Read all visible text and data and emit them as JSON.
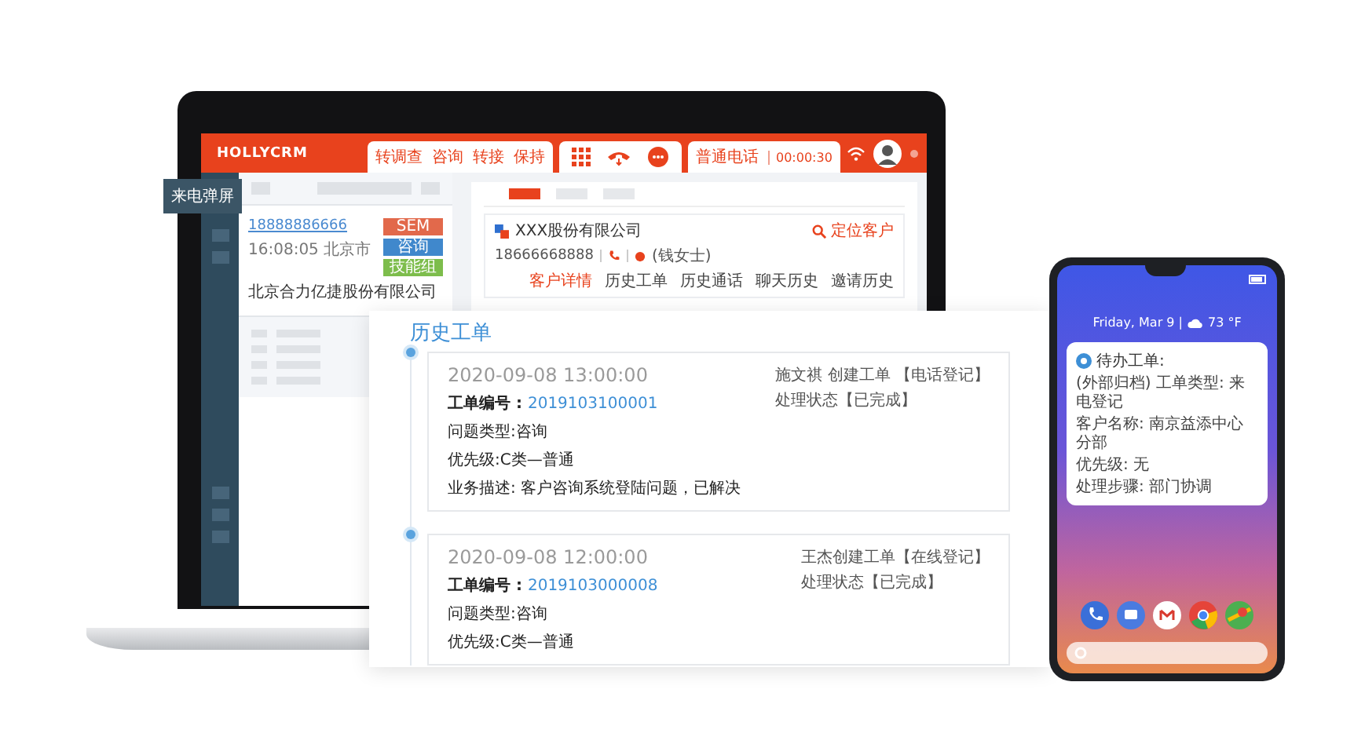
{
  "laptop": {
    "app_name": "HOLLYCRM",
    "call_actions": [
      {
        "label": "转调查"
      },
      {
        "label": "咨询"
      },
      {
        "label": "转接"
      },
      {
        "label": "保持"
      }
    ],
    "call_type": "普通电话",
    "call_timer": "00:00:30",
    "popup_label": "来电弹屏",
    "calls": [
      {
        "phone": "18888886666",
        "time": "16:08:05 北京市",
        "company": "北京合力亿捷股份有限公司",
        "tags": [
          {
            "label": "SEM",
            "color": "#e2694b"
          },
          {
            "label": "咨询",
            "color": "#4088cc"
          },
          {
            "label": "技能组",
            "color": "#7dbd4c"
          }
        ]
      }
    ],
    "customer": {
      "company": "XXX股份有限公司",
      "locate_action": "定位客户",
      "phone": "18666668888",
      "contact": "(钱女士)",
      "tabs": [
        {
          "label": "客户详情",
          "selected": true
        },
        {
          "label": "历史工单",
          "selected": false
        },
        {
          "label": "历史通话",
          "selected": false
        },
        {
          "label": "聊天历史",
          "selected": false
        },
        {
          "label": "邀请历史",
          "selected": false
        }
      ]
    }
  },
  "history": {
    "title": "历史工单",
    "tickets": [
      {
        "time": "2020-09-08 13:00:00",
        "number_label": "工单编号 :",
        "number": "2019103100001",
        "details": [
          "问题类型:咨询",
          "优先级:C类—普通",
          "业务描述: 客户咨询系统登陆问题，已解决"
        ],
        "creator": "施文祺 创建工单 【电话登记】",
        "status": "处理状态【已完成】"
      },
      {
        "time": "2020-09-08 12:00:00",
        "number_label": "工单编号 :",
        "number": "2019103000008",
        "details": [
          "问题类型:咨询",
          "优先级:C类—普通"
        ],
        "creator": "王杰创建工单【在线登记】",
        "status": "处理状态【已完成】"
      }
    ]
  },
  "phone": {
    "date": "Friday, Mar 9 |",
    "temperature": "73 °F",
    "notification": {
      "title": "待办工单:",
      "lines": [
        "(外部归档) 工单类型: 来电登记",
        "客户名称: 南京益添中心分部",
        "优先级: 无",
        "处理步骤: 部门协调"
      ]
    }
  }
}
